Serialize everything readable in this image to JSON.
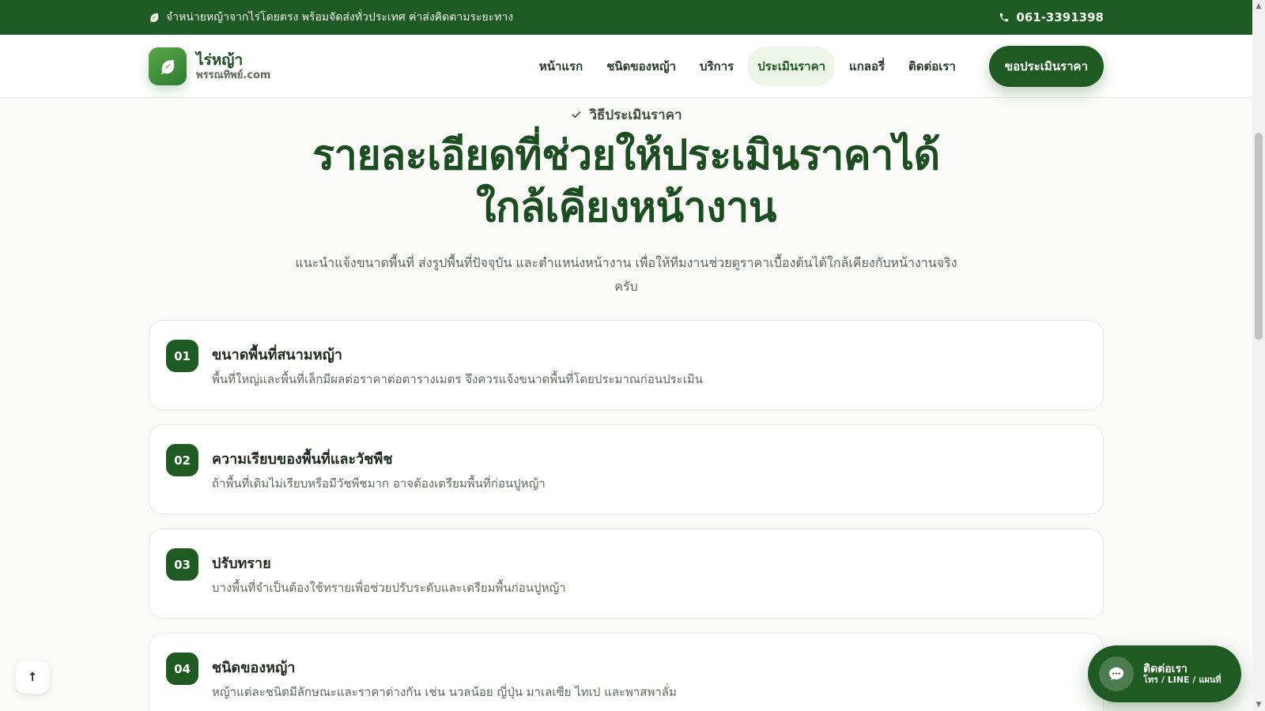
{
  "topbar": {
    "message": "จำหน่ายหญ้าจากไร่โดยตรง พร้อมจัดส่งทั่วประเทศ ค่าส่งคิดตามระยะทาง",
    "phone": "061-3391398"
  },
  "brand": {
    "name": "ไร่หญ้า",
    "domain": "พรรณทิพย์.com"
  },
  "nav": {
    "items": [
      {
        "label": "หน้าแรก"
      },
      {
        "label": "ชนิดของหญ้า"
      },
      {
        "label": "บริการ"
      },
      {
        "label": "ประเมินราคา"
      },
      {
        "label": "แกลอรี่"
      },
      {
        "label": "ติดต่อเรา"
      }
    ],
    "active": "ประเมินราคา",
    "cta": "ขอประเมินราคา"
  },
  "section": {
    "eyebrow": "วิธีประเมินราคา",
    "headline_line1": "รายละเอียดที่ช่วยให้ประเมินราคาได้",
    "headline_line2": "ใกล้เคียงหน้างาน",
    "lead": "แนะนำแจ้งขนาดพื้นที่ ส่งรูปพื้นที่ปัจจุบัน และตำแหน่งหน้างาน เพื่อให้ทีมงานช่วยดูราคาเบื้องต้นได้ใกล้เคียงกับหน้างานจริงครับ"
  },
  "steps": [
    {
      "number": "01",
      "title": "ขนาดพื้นที่สนามหญ้า",
      "desc": "พื้นที่ใหญ่และพื้นที่เล็กมีผลต่อราคาต่อตารางเมตร จึงควรแจ้งขนาดพื้นที่โดยประมาณก่อนประเมิน"
    },
    {
      "number": "02",
      "title": "ความเรียบของพื้นที่และวัชพืช",
      "desc": "ถ้าพื้นที่เดิมไม่เรียบหรือมีวัชพืชมาก อาจต้องเตรียมพื้นที่ก่อนปูหญ้า"
    },
    {
      "number": "03",
      "title": "ปรับทราย",
      "desc": "บางพื้นที่จำเป็นต้องใช้ทรายเพื่อช่วยปรับระดับและเตรียมพื้นก่อนปูหญ้า"
    },
    {
      "number": "04",
      "title": "ชนิดของหญ้า",
      "desc": "หญ้าแต่ละชนิดมีลักษณะและราคาต่างกัน เช่น นวลน้อย ญี่ปุ่น มาเลเซีย ไทเป และพาสพาลั่ม"
    }
  ],
  "fab": {
    "title": "ติดต่อเรา",
    "subtitle": "โทร / LINE / แผนที่"
  },
  "back_to_top": "↑",
  "colors": {
    "brand_green": "#1f5a22",
    "topbar": "#1e5a24",
    "accent_light": "#ecf5e7"
  },
  "icons": {
    "topbar": "leaf-icon",
    "phone": "phone-icon",
    "logo": "leaf-icon",
    "eyebrow": "check-icon",
    "fab": "chat-bubble-icon"
  }
}
